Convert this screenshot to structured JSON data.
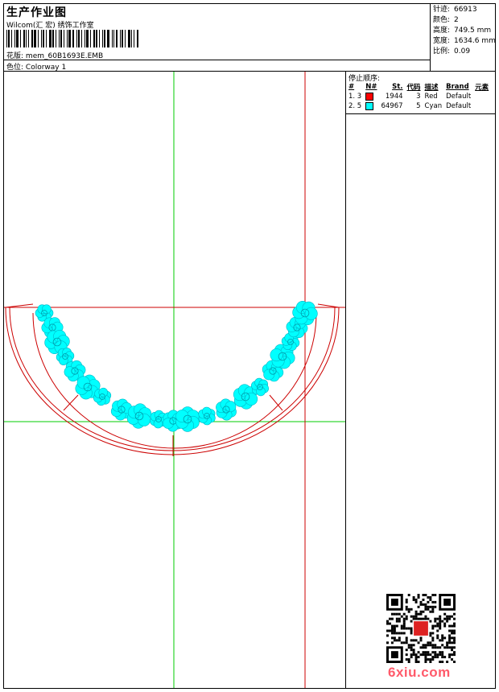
{
  "header": {
    "title": "生产作业图",
    "company": "Wilcom(汇 宏) 绣饰工作室",
    "design_label": "花版:",
    "design_value": "mem_60B1693E.EMB",
    "colorway_label": "色位:",
    "colorway_value": "Colorway 1"
  },
  "stats": [
    {
      "label": "针迹:",
      "value": "66913"
    },
    {
      "label": "颜色:",
      "value": "2"
    },
    {
      "label": "高度:",
      "value": "749.5 mm"
    },
    {
      "label": "宽度:",
      "value": "1634.6 mm"
    },
    {
      "label": "比例:",
      "value": "0.09"
    }
  ],
  "stop_sequence": {
    "title": "停止顺序:",
    "columns": [
      "#",
      "N#",
      "St.",
      "代码",
      "描述",
      "Brand",
      "元素"
    ],
    "rows": [
      {
        "index": "1. 3",
        "color": "#ff0000",
        "stitches": "1944",
        "code": "3",
        "desc": "Red",
        "brand": "Default"
      },
      {
        "index": "2. 5",
        "color": "#00ffff",
        "stitches": "64967",
        "code": "5",
        "desc": "Cyan",
        "brand": "Default"
      }
    ]
  },
  "colors": {
    "guide_green": "#00cc00",
    "guide_red": "#cc0000",
    "outline_red": "#cc0000",
    "embroidery_cyan": "#00ffff",
    "watermark": "#ff5a6a"
  },
  "watermark": {
    "text": "6xiu.com"
  }
}
